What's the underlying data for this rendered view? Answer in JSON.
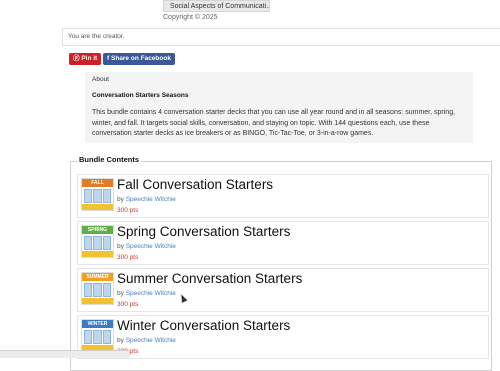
{
  "header": {
    "category_tag": "Social Aspects of Communicati...",
    "copyright": "Copyright © 2025",
    "creator_note": "You are the creator."
  },
  "share": {
    "pin_label": "Pin it",
    "facebook_label": "Share on Facebook"
  },
  "about": {
    "label": "About",
    "title": "Conversation Starters Seasons",
    "body": "This bundle contains 4 conversation starter decks that you can use all year round and in all seasons: summer, spring, winter, and fall. It targets social skills, conversation, and staying on topic. With 144 questions each, use these conversation starter decks as ice breakers or as BINGO, Tic-Tac-Toe, or 3-in-a-row games."
  },
  "bundle": {
    "label": "Bundle Contents",
    "items": [
      {
        "title": "Fall Conversation Starters",
        "by": "by",
        "author": "Speechie Witchie",
        "pts": "300 pts",
        "thumb_label": "FALL",
        "thumb_color": "#e07b26"
      },
      {
        "title": "Spring Conversation Starters",
        "by": "by",
        "author": "Speechie Witchie",
        "pts": "300 pts",
        "thumb_label": "SPRING",
        "thumb_color": "#5fae4a"
      },
      {
        "title": "Summer Conversation Starters",
        "by": "by",
        "author": "Speechie Witchie",
        "pts": "300 pts",
        "thumb_label": "SUMMER",
        "thumb_color": "#f0a020"
      },
      {
        "title": "Winter Conversation Starters",
        "by": "by",
        "author": "Speechie Witchie",
        "pts": "300 pts",
        "thumb_label": "WINTER",
        "thumb_color": "#3a7cc4"
      }
    ]
  }
}
